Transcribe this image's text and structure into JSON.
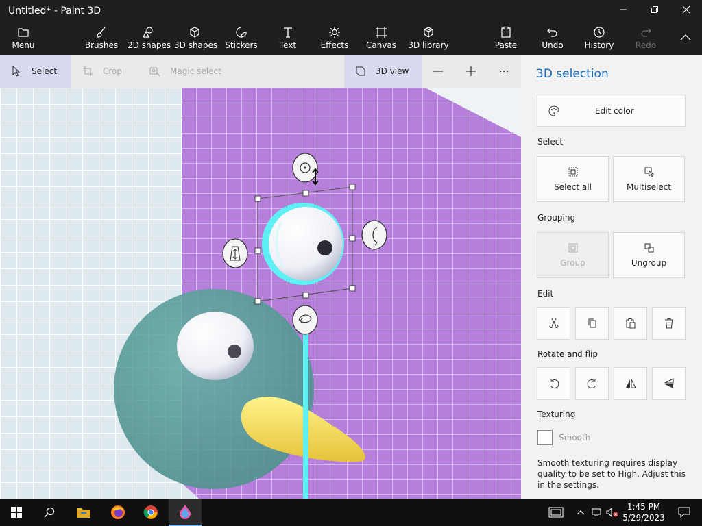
{
  "window": {
    "title": "Untitled* - Paint 3D"
  },
  "ribbon": {
    "menu": "Menu",
    "brushes": "Brushes",
    "shapes2d": "2D shapes",
    "shapes3d": "3D shapes",
    "stickers": "Stickers",
    "text": "Text",
    "effects": "Effects",
    "canvas": "Canvas",
    "library3d": "3D library",
    "paste": "Paste",
    "undo": "Undo",
    "history": "History",
    "redo": "Redo"
  },
  "toolstrip": {
    "select": "Select",
    "crop": "Crop",
    "magic_select": "Magic select",
    "view3d": "3D view"
  },
  "panel": {
    "title": "3D selection",
    "edit_color": "Edit color",
    "select_section": "Select",
    "select_all": "Select all",
    "multiselect": "Multiselect",
    "grouping_section": "Grouping",
    "group": "Group",
    "ungroup": "Ungroup",
    "edit_section": "Edit",
    "rotate_section": "Rotate and flip",
    "texturing_section": "Texturing",
    "smooth": "Smooth",
    "smooth_note": "Smooth texturing requires display quality to be set to High. Adjust this in the settings."
  },
  "taskbar": {
    "time": "1:45 PM",
    "date": "5/29/2023"
  },
  "colors": {
    "accent": "#1a6cb8",
    "chrome": "#1f1f1f",
    "canvas_purple": "#b57fdb",
    "selection_cyan": "#5ff0f5"
  }
}
